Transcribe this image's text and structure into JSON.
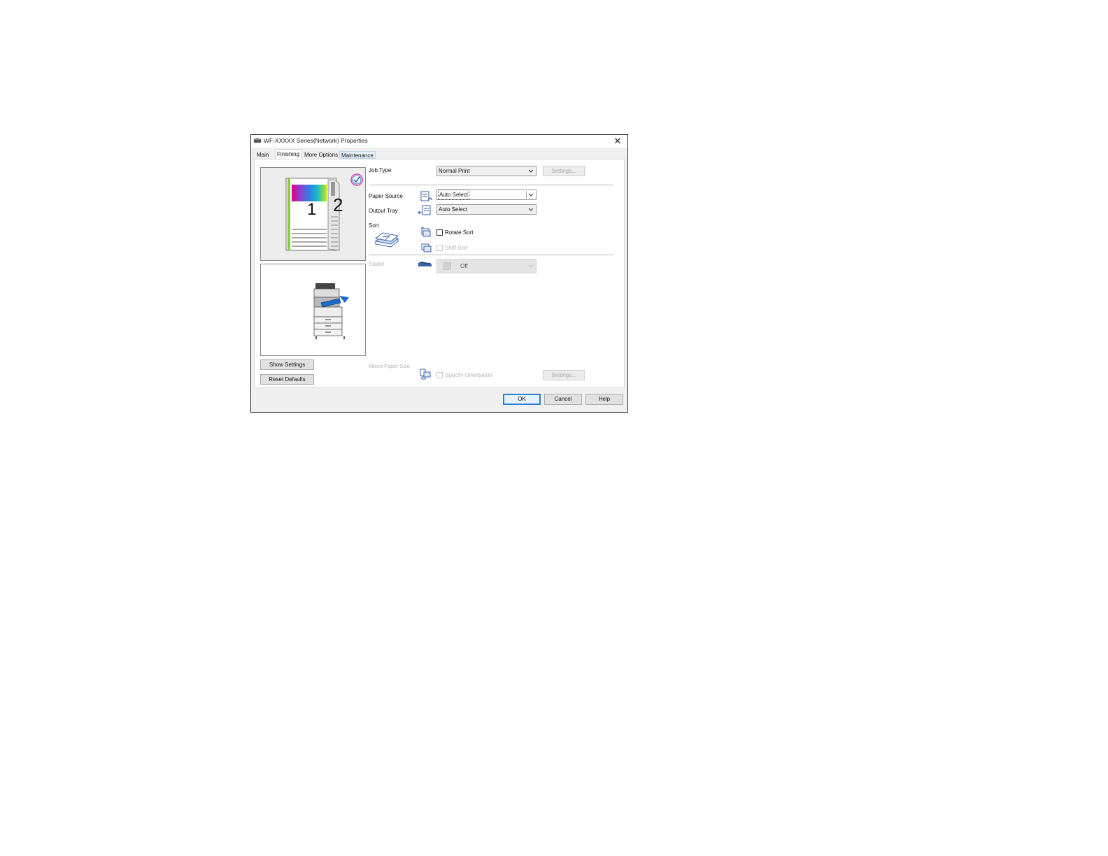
{
  "window": {
    "title": "WF-XXXXX Series(Network) Properties",
    "close_glyph": "✕"
  },
  "tabs": [
    "Main",
    "Finishing",
    "More Options",
    "Maintenance"
  ],
  "preview": {
    "page1": "1",
    "page2": "2"
  },
  "left_buttons": {
    "show_settings": "Show Settings",
    "reset_defaults": "Reset Defaults"
  },
  "job_type": {
    "label": "Job Type",
    "value": "Normal Print",
    "settings": "Settings..."
  },
  "paper_source": {
    "label": "Paper Source",
    "value": "Auto Select"
  },
  "output_tray": {
    "label": "Output Tray",
    "value": "Auto Select"
  },
  "sort": {
    "label": "Sort",
    "rotate_sort": "Rotate Sort",
    "rotate_checked": false,
    "shift_sort": "Shift Sort",
    "shift_checked": false
  },
  "staple": {
    "label": "Staple",
    "value": "Off"
  },
  "mixed_paper": {
    "label": "Mixed Paper Size",
    "specify_orientation": "Specify Orientation",
    "settings": "Settings..."
  },
  "footer": {
    "ok": "OK",
    "cancel": "Cancel",
    "help": "Help"
  },
  "colors": {
    "accent": "#2a7fd4",
    "disabled_text": "#b5b5b5"
  }
}
